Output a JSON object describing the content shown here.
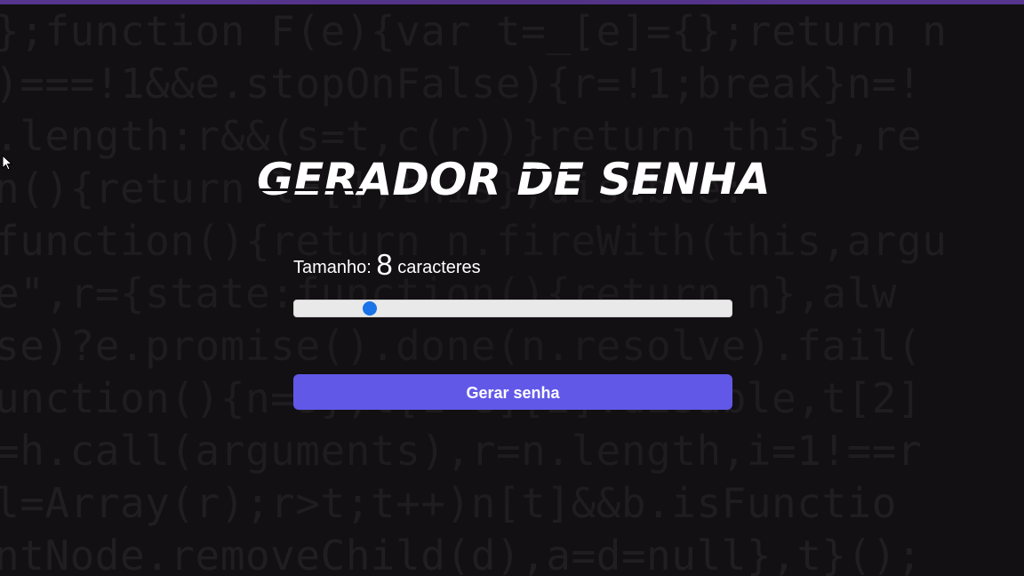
{
  "app": {
    "title": "GERADOR DE SENHA"
  },
  "length": {
    "prefix": "Tamanho: ",
    "value": "8",
    "suffix": " caracteres",
    "slider_position": 0.16
  },
  "actions": {
    "generate_label": "Gerar senha"
  },
  "background_code": [
    "};function F(e){var t=_[e]={};return n",
    ")===!1&&e.stopOnFalse){r=!1;break}n=!",
    ".length:r&&(s=t,c(r))}return this},re",
    "n(){return l=[],this},disable:",
    "function(){return n.fireWith(this,argu",
    "e\",r={state:function(){return n},alw",
    "se)?e.promise().done(n.resolve).fail(",
    "unction(){n=s},t[1^e][2].disable,t[2]",
    "=h.call(arguments),r=n.length,i=1!==r",
    "l=Array(r);r>t;t++)n[t]&&b.isFunctio",
    "ntNode.removeChild(d),a=d=null},t}();"
  ],
  "colors": {
    "accent": "#6158e8",
    "slider_thumb": "#1a73e8",
    "top_bar": "#55358d",
    "background": "#121013"
  },
  "icons": {
    "cursor": "mouse-pointer-icon"
  }
}
